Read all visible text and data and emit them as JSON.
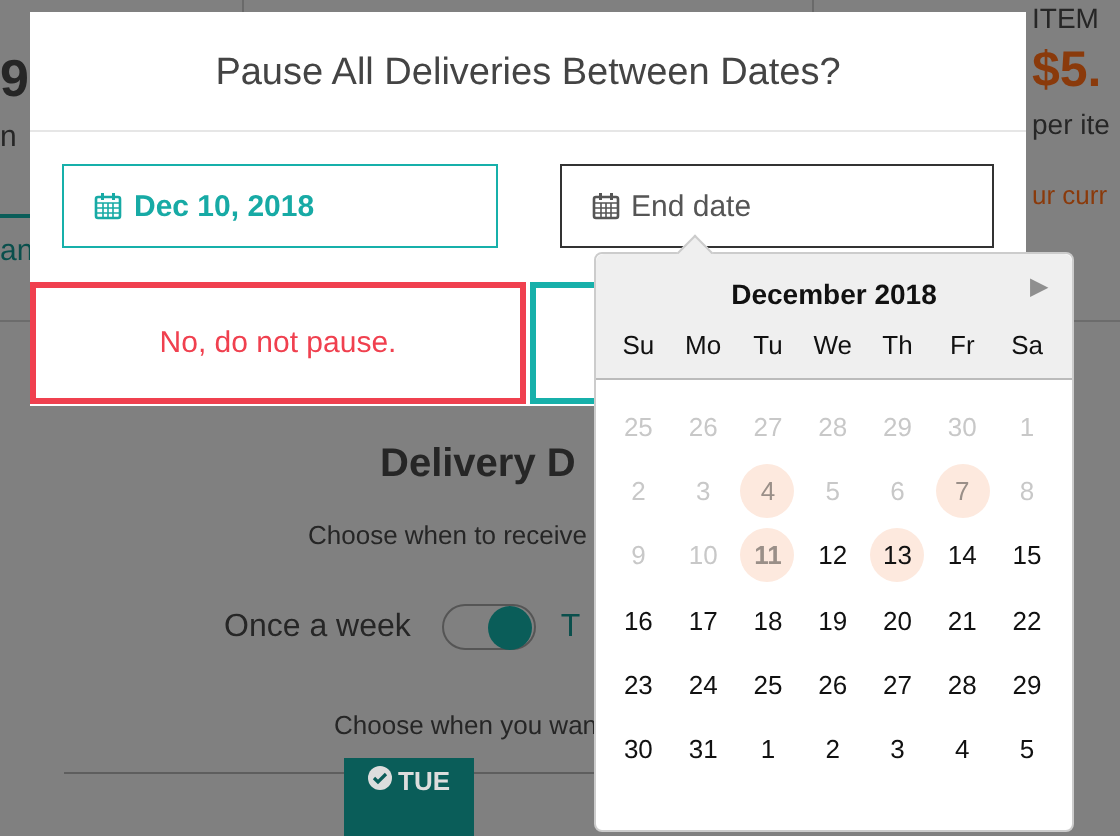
{
  "background": {
    "left_stats": [
      "9",
      "n",
      "an"
    ],
    "right_stats": {
      "label": "ITEM",
      "price": "$5.",
      "unit": "per ite",
      "note": "ur curr"
    },
    "heading": "Delivery D",
    "subtitle": "Choose when to receive",
    "frequency": {
      "label": "Once a week",
      "on": true,
      "alt_label": "T"
    },
    "prompt": "Choose when you wan",
    "day_buttons": [
      {
        "label": "TUE",
        "selected": true
      }
    ]
  },
  "modal": {
    "title": "Pause All Deliveries Between Dates?",
    "start_date": {
      "value": "Dec 10, 2018"
    },
    "end_date": {
      "placeholder": "End date"
    },
    "buttons": [
      {
        "kind": "cancel",
        "label": "No, do not pause."
      },
      {
        "kind": "confirm"
      }
    ]
  },
  "calendar": {
    "month": "December 2018",
    "next": "▶",
    "weekdays": [
      "Su",
      "Mo",
      "Tu",
      "We",
      "Th",
      "Fr",
      "Sa"
    ],
    "weeks": [
      [
        {
          "label": "25",
          "disabled": true,
          "highlighted": false,
          "selected": false
        },
        {
          "label": "26",
          "disabled": true,
          "highlighted": false,
          "selected": false
        },
        {
          "label": "27",
          "disabled": true,
          "highlighted": false,
          "selected": false
        },
        {
          "label": "28",
          "disabled": true,
          "highlighted": false,
          "selected": false
        },
        {
          "label": "29",
          "disabled": true,
          "highlighted": false,
          "selected": false
        },
        {
          "label": "30",
          "disabled": true,
          "highlighted": false,
          "selected": false
        },
        {
          "label": "1",
          "disabled": true,
          "highlighted": false,
          "selected": false
        }
      ],
      [
        {
          "label": "2",
          "disabled": true,
          "highlighted": false,
          "selected": false
        },
        {
          "label": "3",
          "disabled": true,
          "highlighted": false,
          "selected": false
        },
        {
          "label": "4",
          "disabled": true,
          "highlighted": true,
          "selected": false
        },
        {
          "label": "5",
          "disabled": true,
          "highlighted": false,
          "selected": false
        },
        {
          "label": "6",
          "disabled": true,
          "highlighted": false,
          "selected": false
        },
        {
          "label": "7",
          "disabled": true,
          "highlighted": true,
          "selected": false
        },
        {
          "label": "8",
          "disabled": true,
          "highlighted": false,
          "selected": false
        }
      ],
      [
        {
          "label": "9",
          "disabled": true,
          "highlighted": false,
          "selected": false
        },
        {
          "label": "10",
          "disabled": true,
          "highlighted": false,
          "selected": false
        },
        {
          "label": "11",
          "disabled": true,
          "highlighted": true,
          "selected": true
        },
        {
          "label": "12",
          "disabled": false,
          "highlighted": false,
          "selected": false
        },
        {
          "label": "13",
          "disabled": false,
          "highlighted": true,
          "selected": false
        },
        {
          "label": "14",
          "disabled": false,
          "highlighted": false,
          "selected": false
        },
        {
          "label": "15",
          "disabled": false,
          "highlighted": false,
          "selected": false
        }
      ],
      [
        {
          "label": "16",
          "disabled": false,
          "highlighted": false,
          "selected": false
        },
        {
          "label": "17",
          "disabled": false,
          "highlighted": false,
          "selected": false
        },
        {
          "label": "18",
          "disabled": false,
          "highlighted": false,
          "selected": false
        },
        {
          "label": "19",
          "disabled": false,
          "highlighted": false,
          "selected": false
        },
        {
          "label": "20",
          "disabled": false,
          "highlighted": false,
          "selected": false
        },
        {
          "label": "21",
          "disabled": false,
          "highlighted": false,
          "selected": false
        },
        {
          "label": "22",
          "disabled": false,
          "highlighted": false,
          "selected": false
        }
      ],
      [
        {
          "label": "23",
          "disabled": false,
          "highlighted": false,
          "selected": false
        },
        {
          "label": "24",
          "disabled": false,
          "highlighted": false,
          "selected": false
        },
        {
          "label": "25",
          "disabled": false,
          "highlighted": false,
          "selected": false
        },
        {
          "label": "26",
          "disabled": false,
          "highlighted": false,
          "selected": false
        },
        {
          "label": "27",
          "disabled": false,
          "highlighted": false,
          "selected": false
        },
        {
          "label": "28",
          "disabled": false,
          "highlighted": false,
          "selected": false
        },
        {
          "label": "29",
          "disabled": false,
          "highlighted": false,
          "selected": false
        }
      ],
      [
        {
          "label": "30",
          "disabled": false,
          "highlighted": false,
          "selected": false
        },
        {
          "label": "31",
          "disabled": false,
          "highlighted": false,
          "selected": false
        },
        {
          "label": "1",
          "disabled": false,
          "highlighted": false,
          "selected": false
        },
        {
          "label": "2",
          "disabled": false,
          "highlighted": false,
          "selected": false
        },
        {
          "label": "3",
          "disabled": false,
          "highlighted": false,
          "selected": false
        },
        {
          "label": "4",
          "disabled": false,
          "highlighted": false,
          "selected": false
        },
        {
          "label": "5",
          "disabled": false,
          "highlighted": false,
          "selected": false
        }
      ]
    ]
  }
}
